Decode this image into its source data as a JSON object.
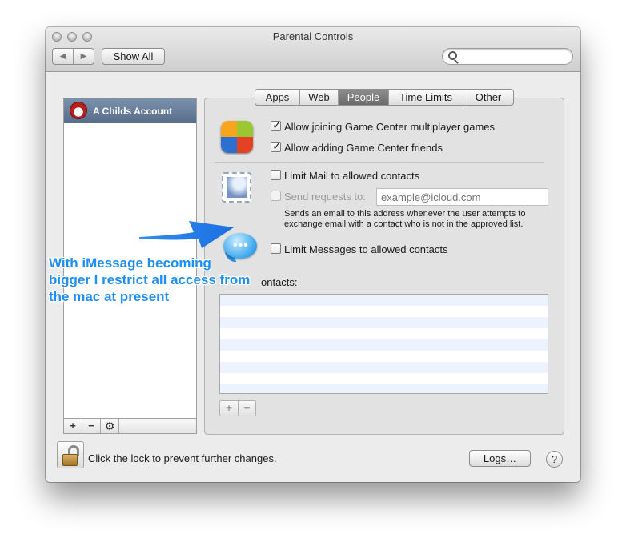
{
  "window": {
    "title": "Parental Controls"
  },
  "toolbar": {
    "back_glyph": "◀",
    "forward_glyph": "▶",
    "show_all_label": "Show All",
    "search_placeholder": ""
  },
  "sidebar": {
    "accounts": [
      {
        "label": "A Childs Account",
        "selected": true
      }
    ],
    "tools": {
      "add": "+",
      "remove": "−",
      "action": "⚙"
    }
  },
  "tabs": [
    {
      "label": "Apps",
      "selected": false
    },
    {
      "label": "Web",
      "selected": false
    },
    {
      "label": "People",
      "selected": true
    },
    {
      "label": "Time Limits",
      "selected": false
    },
    {
      "label": "Other",
      "selected": false
    }
  ],
  "game_center": {
    "icon": "game-center-icon",
    "allow_multiplayer": {
      "label": "Allow joining Game Center multiplayer games",
      "checked": true
    },
    "allow_friends": {
      "label": "Allow adding Game Center friends",
      "checked": true
    }
  },
  "mail": {
    "icon": "mail-icon",
    "limit": {
      "label": "Limit Mail to allowed contacts",
      "checked": false
    },
    "send_requests": {
      "label": "Send requests to:",
      "checked": false,
      "enabled": false
    },
    "email_placeholder": "example@icloud.com",
    "description_line1": "Sends an email to this address whenever the user attempts to",
    "description_line2": "exchange email with a contact who is not in the approved list."
  },
  "messages": {
    "icon": "messages-icon",
    "limit": {
      "label": "Limit Messages to allowed contacts",
      "checked": false
    }
  },
  "contacts": {
    "label_fragment": "ontacts:",
    "rows": [],
    "tools": {
      "add": "+",
      "remove": "−"
    }
  },
  "footer": {
    "lock_text": "Click the lock to prevent further changes.",
    "logs_label": "Logs…",
    "help_label": "?"
  },
  "annotation": {
    "line1": "With iMessage becoming",
    "line2": "bigger I restrict all access from",
    "line3": "the mac at present",
    "color": "#1f8ff1"
  },
  "colors": {
    "selected_row": "#6a809c",
    "selected_tab": "#7a7a7a",
    "stripe": "#edf3fe"
  }
}
